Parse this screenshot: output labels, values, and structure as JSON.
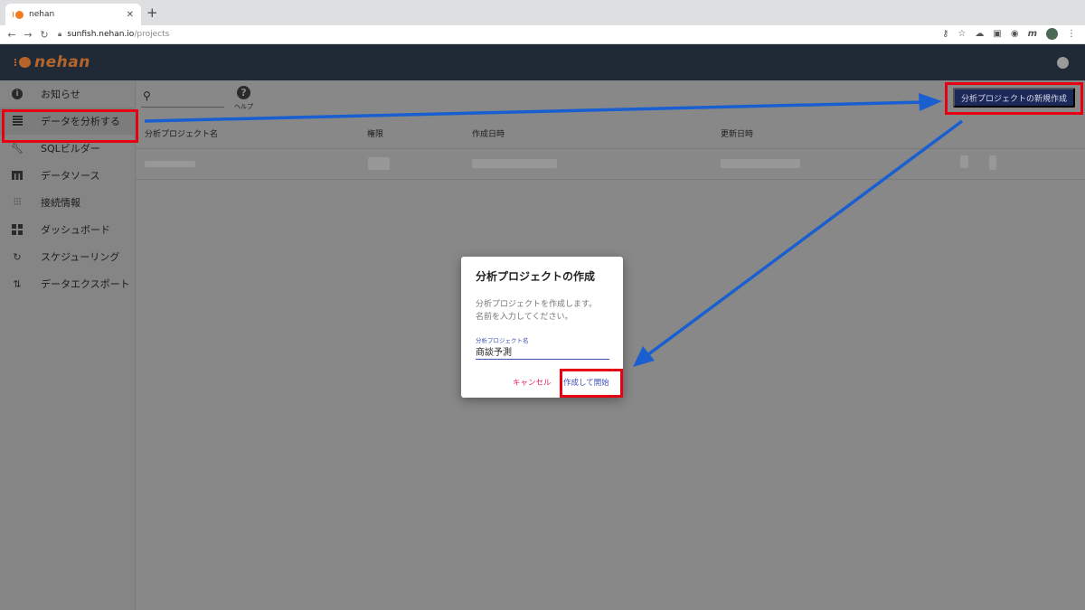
{
  "browser": {
    "tab_title": "nehan",
    "tab_close": "✕",
    "new_tab": "+",
    "url_host": "sunfish.nehan.io",
    "url_path": "/projects",
    "ext_m": "m"
  },
  "header": {
    "logo_text": "nehan"
  },
  "sidebar": {
    "items": [
      {
        "label": "お知らせ",
        "icon": "info-icon"
      },
      {
        "label": "データを分析する",
        "icon": "analyze-icon"
      },
      {
        "label": "SQLビルダー",
        "icon": "wrench-icon"
      },
      {
        "label": "データソース",
        "icon": "table-icon"
      },
      {
        "label": "接続情報",
        "icon": "sliders-icon"
      },
      {
        "label": "ダッシュボード",
        "icon": "dashboard-icon"
      },
      {
        "label": "スケジューリング",
        "icon": "schedule-icon"
      },
      {
        "label": "データエクスポート",
        "icon": "export-icon"
      }
    ]
  },
  "toolbar": {
    "help_label": "ヘルプ",
    "new_project_label": "分析プロジェクトの新規作成"
  },
  "table": {
    "headers": [
      "分析プロジェクト名",
      "権限",
      "作成日時",
      "更新日時"
    ]
  },
  "dialog": {
    "title": "分析プロジェクトの作成",
    "description_line1": "分析プロジェクトを作成します。",
    "description_line2": "名前を入力してください。",
    "field_label": "分析プロジェクト名",
    "field_value": "商談予測",
    "cancel_label": "キャンセル",
    "start_label": "作成して開始"
  },
  "colors": {
    "highlight": "#e60012",
    "arrow": "#1a5fd0",
    "primary_button": "#1c2857",
    "cancel": "#e91e63",
    "accent": "#3f51b5"
  }
}
